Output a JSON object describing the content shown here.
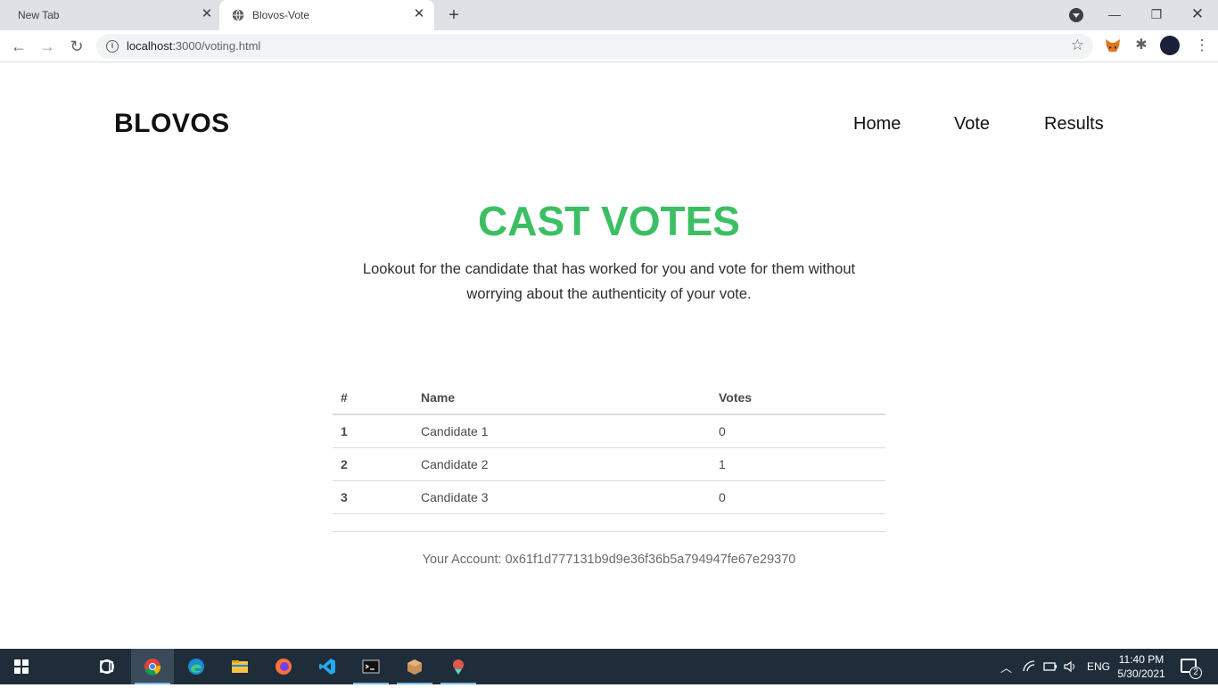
{
  "browser": {
    "tabs": [
      {
        "title": "New Tab",
        "active": false
      },
      {
        "title": "Blovos-Vote",
        "active": true
      }
    ],
    "address": {
      "host": "localhost",
      "path": ":3000/voting.html"
    }
  },
  "site": {
    "brand": "BLOVOS",
    "nav": [
      "Home",
      "Vote",
      "Results"
    ]
  },
  "hero": {
    "title": "CAST VOTES",
    "subtitle": "Lookout for the candidate that has worked for you and vote for them without worrying about the authenticity of your vote."
  },
  "table": {
    "headers": [
      "#",
      "Name",
      "Votes"
    ],
    "rows": [
      {
        "num": "1",
        "name": "Candidate 1",
        "votes": "0"
      },
      {
        "num": "2",
        "name": "Candidate 2",
        "votes": "1"
      },
      {
        "num": "3",
        "name": "Candidate 3",
        "votes": "0"
      }
    ]
  },
  "account": "Your Account: 0x61f1d777131b9d9e36f36b5a794947fe67e29370",
  "taskbar": {
    "apps": [
      "windows-start",
      "search",
      "task-view",
      "chrome",
      "edge",
      "file-explorer",
      "firefox",
      "vscode",
      "terminal",
      "box-app",
      "truffle-app"
    ],
    "language": "ENG",
    "time": "11:40 PM",
    "date": "5/30/2021",
    "notification_count": "2"
  },
  "colors": {
    "accent": "#3cbf63",
    "taskbar": "#1f2d3a",
    "tabbar": "#dee1e6"
  }
}
